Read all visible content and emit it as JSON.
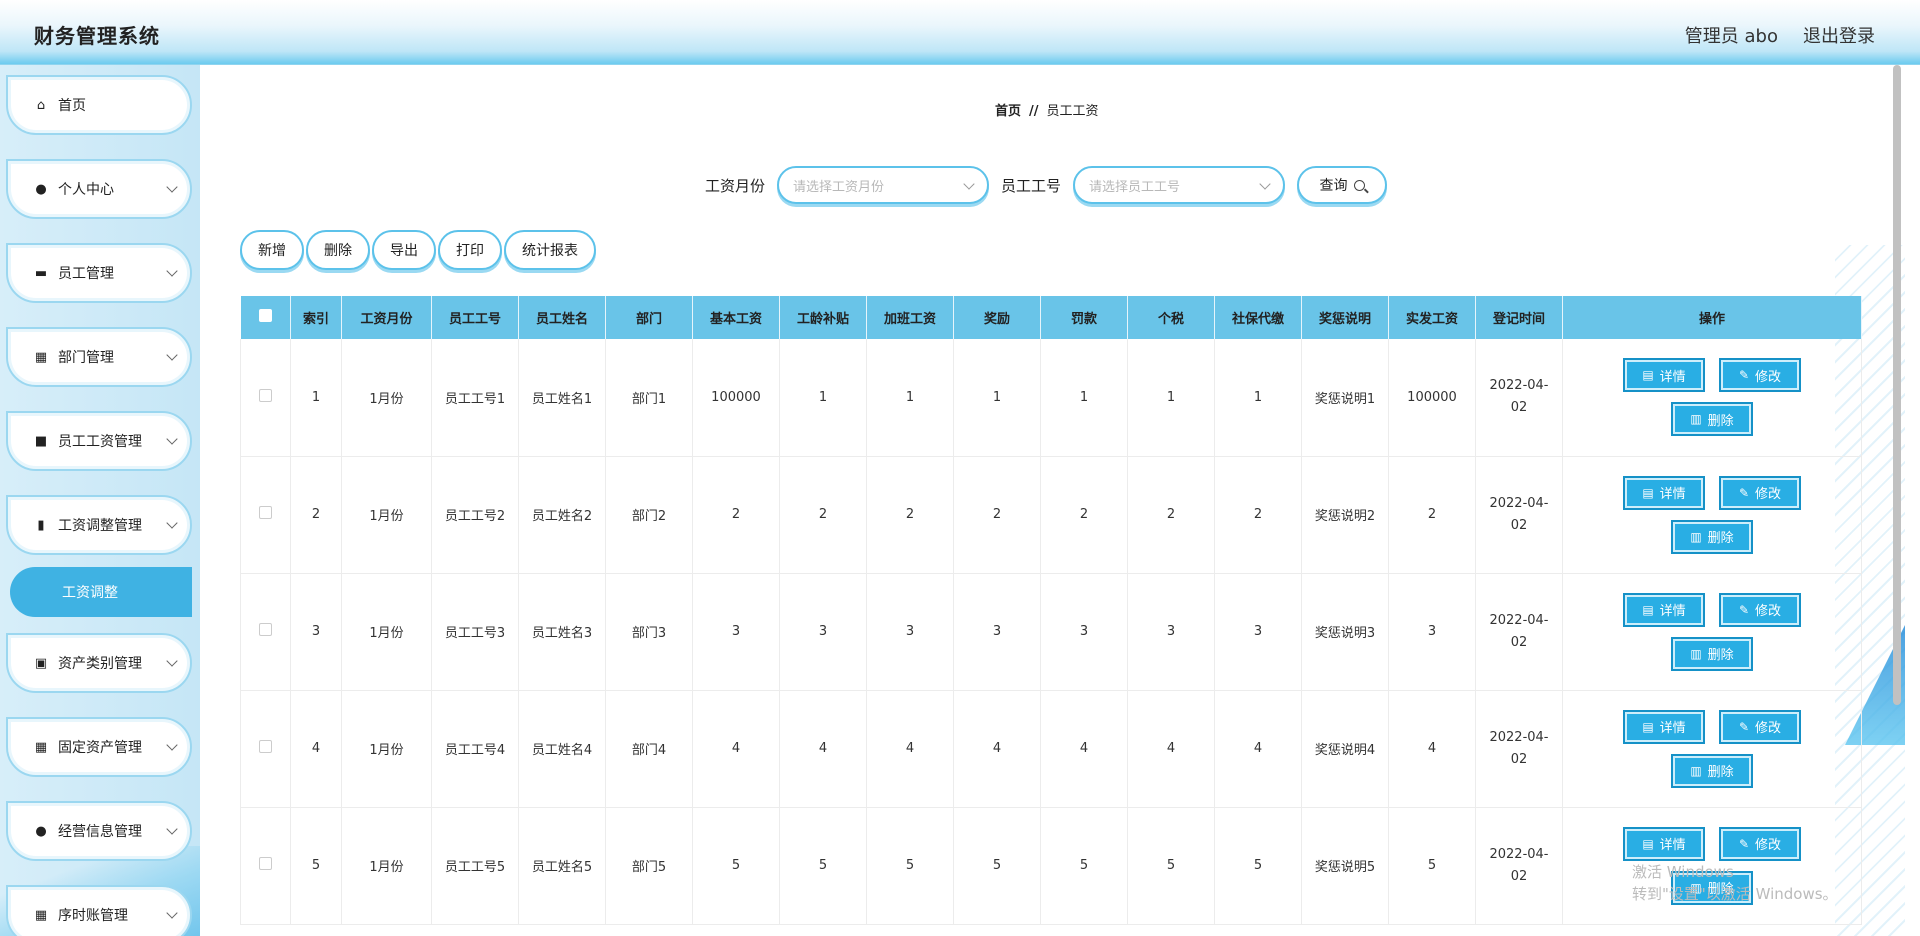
{
  "header": {
    "title": "财务管理系统",
    "user": "管理员 abo",
    "logout": "退出登录"
  },
  "sidebar": {
    "items": [
      {
        "label": "首页",
        "icon": "home-icon",
        "glyph": "⌂",
        "chevron": false
      },
      {
        "label": "个人中心",
        "icon": "person-icon",
        "glyph": "●",
        "chevron": true
      },
      {
        "label": "员工管理",
        "icon": "flag-icon",
        "glyph": "▬",
        "chevron": true
      },
      {
        "label": "部门管理",
        "icon": "grid-icon",
        "glyph": "▦",
        "chevron": true
      },
      {
        "label": "员工工资管理",
        "icon": "briefcase-icon",
        "glyph": "■",
        "chevron": true
      },
      {
        "label": "工资调整管理",
        "icon": "bar-chart-icon",
        "glyph": "▮",
        "chevron": true
      },
      {
        "label": "资产类别管理",
        "icon": "clipboard-icon",
        "glyph": "▣",
        "chevron": true
      },
      {
        "label": "固定资产管理",
        "icon": "grid-icon",
        "glyph": "▦",
        "chevron": true
      },
      {
        "label": "经营信息管理",
        "icon": "bulb-icon",
        "glyph": "●",
        "chevron": true
      },
      {
        "label": "序时账管理",
        "icon": "grid-icon",
        "glyph": "▦",
        "chevron": true
      }
    ],
    "active_sub": "工资调整"
  },
  "breadcrumb": {
    "home": "首页",
    "sep": "//",
    "current": "员工工资"
  },
  "search": {
    "month_label": "工资月份",
    "month_placeholder": "请选择工资月份",
    "emp_label": "员工工号",
    "emp_placeholder": "请选择员工工号",
    "query": "查询"
  },
  "toolbar": {
    "add": "新增",
    "delete": "删除",
    "export": "导出",
    "print": "打印",
    "report": "统计报表"
  },
  "table": {
    "columns": [
      "索引",
      "工资月份",
      "员工工号",
      "员工姓名",
      "部门",
      "基本工资",
      "工龄补贴",
      "加班工资",
      "奖励",
      "罚款",
      "个税",
      "社保代缴",
      "奖惩说明",
      "实发工资",
      "登记时间",
      "操作"
    ],
    "rows": [
      [
        "1",
        "1月份",
        "员工工号1",
        "员工姓名1",
        "部门1",
        "100000",
        "1",
        "1",
        "1",
        "1",
        "1",
        "1",
        "奖惩说明1",
        "100000",
        "2022-04-02"
      ],
      [
        "2",
        "1月份",
        "员工工号2",
        "员工姓名2",
        "部门2",
        "2",
        "2",
        "2",
        "2",
        "2",
        "2",
        "2",
        "奖惩说明2",
        "2",
        "2022-04-02"
      ],
      [
        "3",
        "1月份",
        "员工工号3",
        "员工姓名3",
        "部门3",
        "3",
        "3",
        "3",
        "3",
        "3",
        "3",
        "3",
        "奖惩说明3",
        "3",
        "2022-04-02"
      ],
      [
        "4",
        "1月份",
        "员工工号4",
        "员工姓名4",
        "部门4",
        "4",
        "4",
        "4",
        "4",
        "4",
        "4",
        "4",
        "奖惩说明4",
        "4",
        "2022-04-02"
      ],
      [
        "5",
        "1月份",
        "员工工号5",
        "员工姓名5",
        "部门5",
        "5",
        "5",
        "5",
        "5",
        "5",
        "5",
        "5",
        "奖惩说明5",
        "5",
        "2022-04-02"
      ]
    ],
    "ops": {
      "detail": "详情",
      "edit": "修改",
      "delete": "删除"
    }
  },
  "watermark": {
    "line1": "激活 Windows",
    "line2": "转到\"设置\"以激活 Windows。"
  },
  "colors": {
    "accent": "#29aee4",
    "header_bar": "#69c4e8",
    "sidebar_bg": "#c5e6f6"
  }
}
